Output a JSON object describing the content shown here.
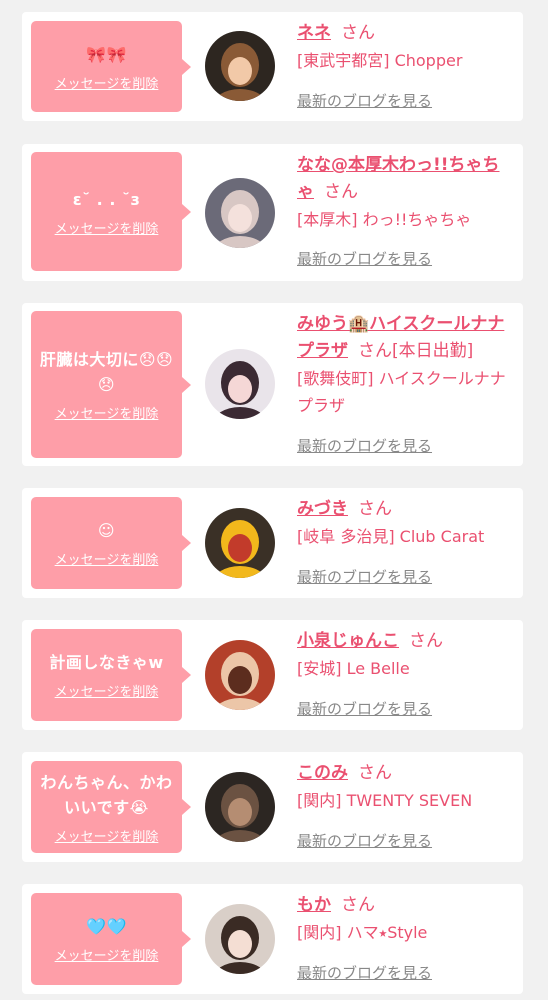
{
  "common": {
    "delete_label": "メッセージを削除",
    "blog_label": "最新のブログを見る",
    "san": "さん"
  },
  "colors": {
    "bubble": "#fe9ea8",
    "accent": "#ea5070",
    "muted": "#888888",
    "background": "#f1f1f1"
  },
  "cards": [
    {
      "message": "🎀🎀",
      "name": "ネネ",
      "status": "",
      "shop": "[東武宇都宮] Chopper",
      "avatar_colors": [
        "#2d2620",
        "#8a5a36",
        "#f2c9a8"
      ]
    },
    {
      "message": "ε˘ . . ˘з",
      "name": "なな@本厚木わっ!!ちゃちゃ",
      "status": "",
      "shop": "[本厚木] わっ!!ちゃちゃ",
      "avatar_colors": [
        "#6b6a78",
        "#d8c7c4",
        "#f4e1dc"
      ]
    },
    {
      "message": "肝臓は大切に😞😞😞",
      "name": "みゆう🏨ハイスクールナナプラザ",
      "status": "[本日出勤]",
      "shop": "[歌舞伎町] ハイスクールナナプラザ",
      "avatar_colors": [
        "#e9e4ea",
        "#3b2a33",
        "#f5d7d6"
      ]
    },
    {
      "message": "☺︎",
      "name": "みづき",
      "status": "",
      "shop": "[岐阜 多治見] Club Carat",
      "avatar_colors": [
        "#3a3026",
        "#f2b81c",
        "#c23b2b"
      ]
    },
    {
      "message": "計画しなきゃw",
      "name": "小泉じゅんこ",
      "status": "",
      "shop": "[安城] Le Belle",
      "avatar_colors": [
        "#b3402a",
        "#ecc6a8",
        "#5c2d1e"
      ]
    },
    {
      "message": "わんちゃん、かわいいです😭",
      "name": "このみ",
      "status": "",
      "shop": "[関内] TWENTY SEVEN",
      "avatar_colors": [
        "#2c2622",
        "#6b5242",
        "#b58d72"
      ]
    },
    {
      "message": "🩵🩵",
      "name": "もか",
      "status": "",
      "shop": "[関内] ハマ⭑Style",
      "avatar_colors": [
        "#d9cfc8",
        "#3a2b24",
        "#f4ded3"
      ]
    }
  ]
}
